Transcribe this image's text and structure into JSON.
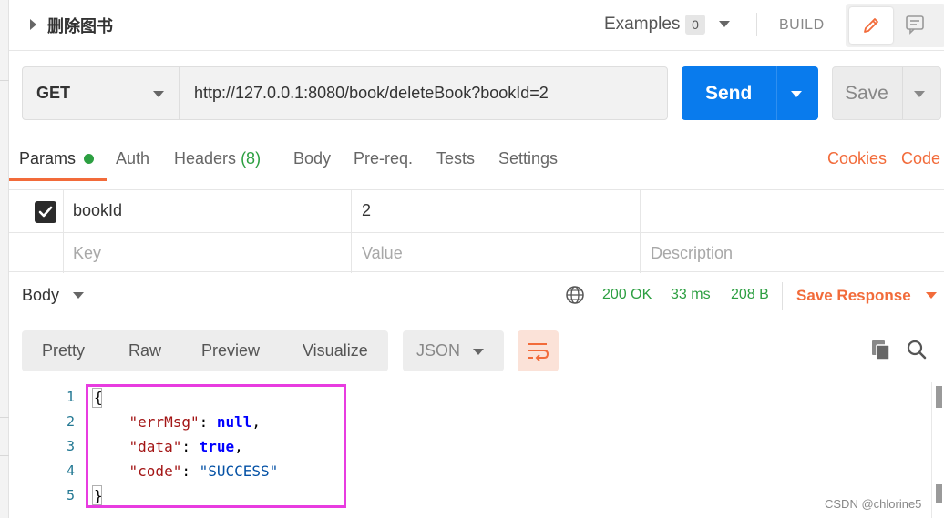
{
  "request": {
    "name": "删除图书",
    "method": "GET",
    "url": "http://127.0.0.1:8080/book/deleteBook?bookId=2"
  },
  "topbar": {
    "examples_label": "Examples",
    "examples_count": "0",
    "build_label": "BUILD",
    "edit_icon": "pencil-icon",
    "comment_icon": "comment-icon"
  },
  "actions": {
    "send_label": "Send",
    "save_label": "Save"
  },
  "request_tabs": {
    "params": "Params",
    "auth": "Auth",
    "headers": "Headers",
    "headers_count": "(8)",
    "body": "Body",
    "prereq": "Pre-req.",
    "tests": "Tests",
    "settings": "Settings",
    "cookies": "Cookies",
    "code": "Code",
    "active": "Params",
    "accent_color": "#f26b3a",
    "indicator_color": "#2c9f41"
  },
  "params": {
    "rows": [
      {
        "checked": true,
        "key": "bookId",
        "value": "2",
        "description": ""
      }
    ],
    "placeholders": {
      "key": "Key",
      "value": "Value",
      "description": "Description"
    }
  },
  "response": {
    "section_label": "Body",
    "status": "200 OK",
    "time": "33 ms",
    "size": "208 B",
    "save_response_label": "Save Response",
    "status_color": "#2c9f41"
  },
  "view": {
    "tabs": [
      "Pretty",
      "Raw",
      "Preview",
      "Visualize"
    ],
    "active_tab": "Pretty",
    "format": "JSON",
    "wrap_icon": "wrap-lines-icon",
    "copy_icon": "copy-icon",
    "search_icon": "search-icon"
  },
  "code": {
    "line_numbers": [
      "1",
      "2",
      "3",
      "4",
      "5"
    ],
    "open_brace": "{",
    "close_brace": "}",
    "entries": [
      {
        "key": "\"errMsg\"",
        "value": "null",
        "sep": ","
      },
      {
        "key": "\"data\"",
        "value": "true",
        "sep": ","
      },
      {
        "key": "\"code\"",
        "value": "\"SUCCESS\"",
        "sep": ""
      }
    ]
  },
  "watermark": "CSDN @chlorine5"
}
